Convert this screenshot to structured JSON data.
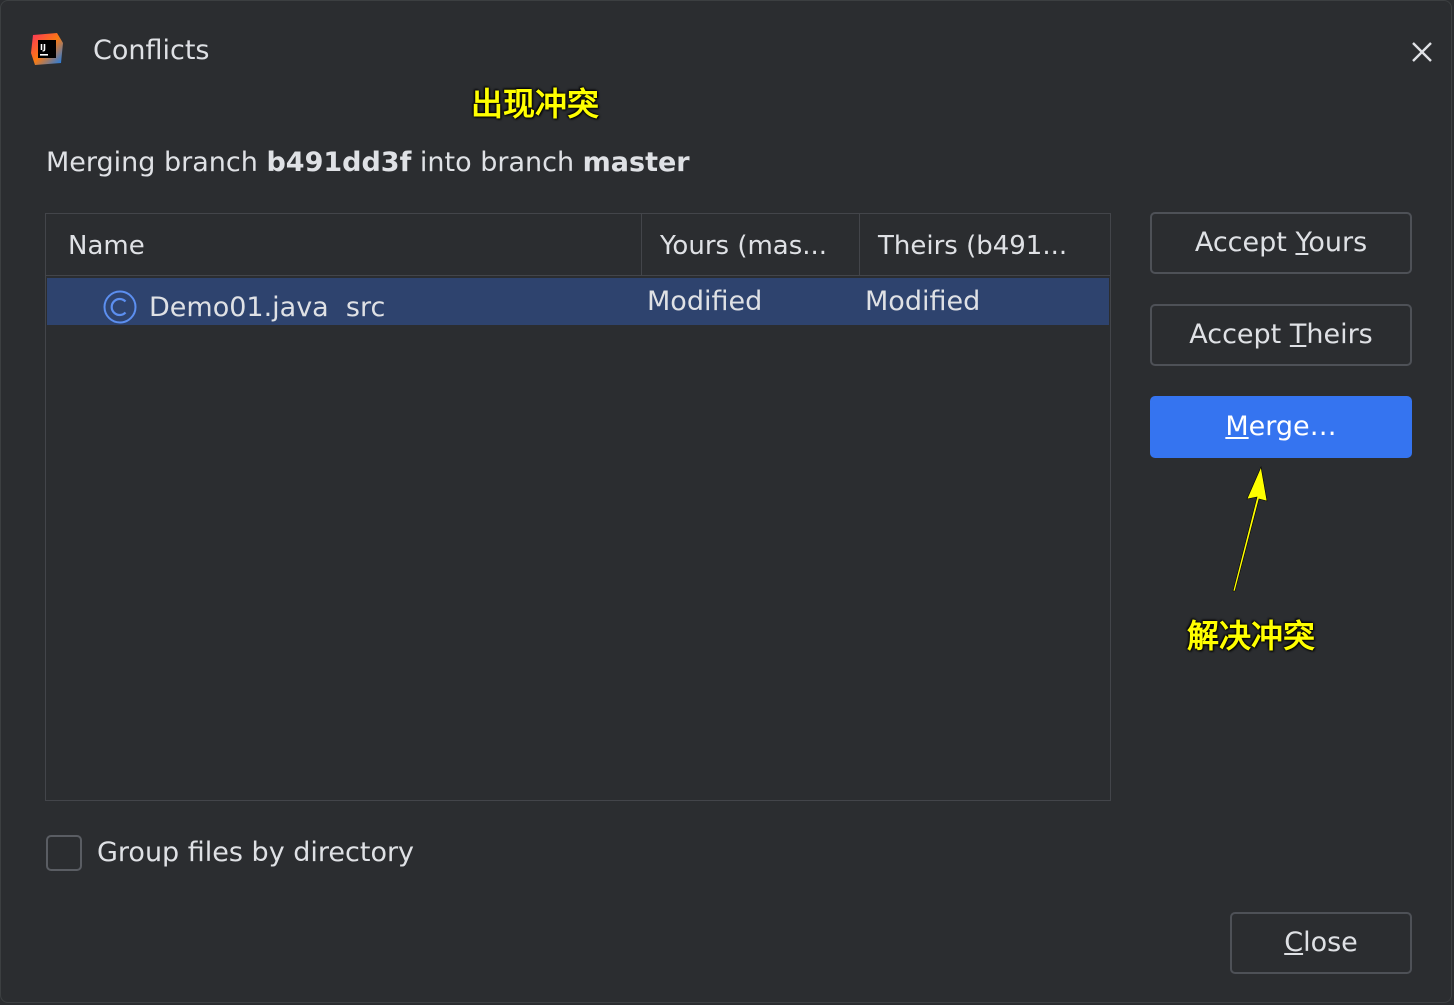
{
  "window": {
    "title": "Conflicts",
    "logo_icon": "intellij-idea-icon",
    "close_icon": "close-icon"
  },
  "annotations": {
    "top": "出现冲突",
    "bottom": "解决冲突",
    "color": "#ffff00"
  },
  "subtitle": {
    "prefix": "Merging branch ",
    "source_branch": "b491dd3f",
    "middle": " into branch ",
    "target_branch": "master"
  },
  "table": {
    "columns": {
      "name": "Name",
      "yours": "Yours (mas...",
      "theirs": "Theirs (b491..."
    },
    "rows": [
      {
        "icon": "java-class-icon",
        "file": "Demo01.java",
        "location": "src",
        "yours": "Modified",
        "theirs": "Modified"
      }
    ]
  },
  "buttons": {
    "accept_yours": {
      "before": "Accept ",
      "mnemonic": "Y",
      "after": "ours"
    },
    "accept_theirs": {
      "before": "Accept ",
      "mnemonic": "T",
      "after": "heirs"
    },
    "merge": {
      "before": "",
      "mnemonic": "M",
      "after": "erge…"
    },
    "close": {
      "before": "",
      "mnemonic": "C",
      "after": "lose"
    }
  },
  "options": {
    "group_by_directory": {
      "label": "Group files by directory",
      "checked": false
    }
  },
  "colors": {
    "background": "#2b2d30",
    "selection": "#2e436e",
    "primary_button": "#3574f0",
    "icon_blue": "#5c8ff0"
  }
}
